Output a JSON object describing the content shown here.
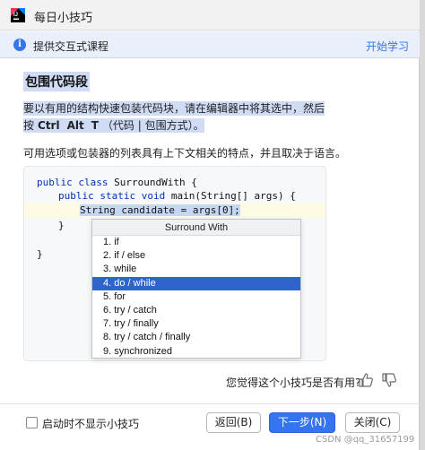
{
  "window": {
    "title": "每日小技巧"
  },
  "infobar": {
    "text": "提供交互式课程",
    "link": "开始学习"
  },
  "tip": {
    "heading": "包围代码段",
    "desc_line1": "要以有用的结构快速包装代码块，请在编辑器中将其选中，然后",
    "desc_prefix": "按",
    "shortcut_keys": [
      "Ctrl",
      "Alt",
      "T"
    ],
    "desc_suffix": "（代码 | 包围方式）。",
    "desc2": "可用选项或包装器的列表具有上下文相关的特点，并且取决于语言。"
  },
  "code": {
    "line1_kw": "public class",
    "line1_rest": " SurroundWith {",
    "line2_kw": "public static void",
    "line2_rest": " main(String[] args) {",
    "line3": "String candidate = args[0];",
    "line4": "}",
    "line5": "}"
  },
  "popup": {
    "title": "Surround With",
    "items": [
      "1. if",
      "2. if / else",
      "3. while",
      "4. do / while",
      "5. for",
      "6. try / catch",
      "7. try / finally",
      "8. try / catch / finally",
      "9. synchronized"
    ],
    "selected_index": 3
  },
  "feedback": {
    "question": "您觉得这个小技巧是否有用?"
  },
  "footer": {
    "checkbox_label": "启动时不显示小技巧",
    "back_label": "返回(B)",
    "next_label": "下一步(N)",
    "close_label": "关闭(C)"
  },
  "watermark": "CSDN @qq_31657199",
  "colors": {
    "accent": "#3574f0",
    "selection": "#2f65ca",
    "highlight": "#cfdcf4"
  }
}
